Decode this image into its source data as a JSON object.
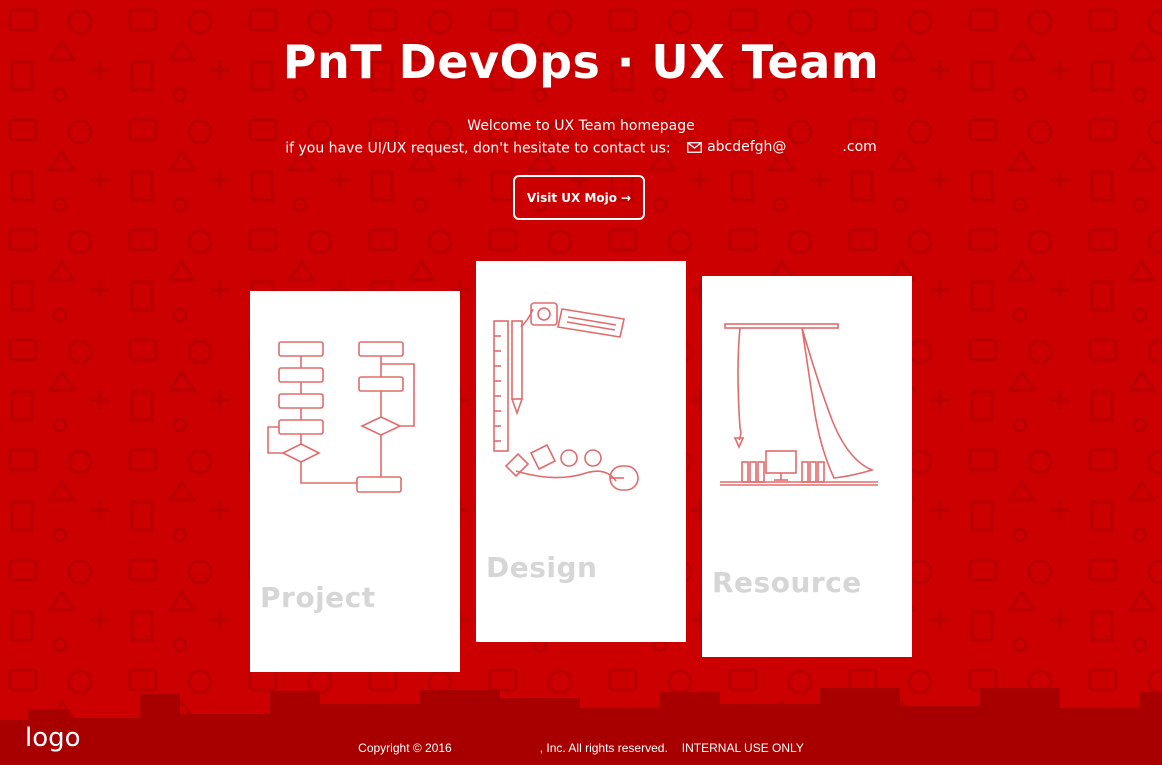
{
  "header": {
    "title": "PnT DevOps · UX Team",
    "welcome": "Welcome to UX Team homepage",
    "contact_prompt": "if you have UI/UX request, don't hesitate to contact us:",
    "email_user": "abcdefgh@",
    "email_domain": ".com"
  },
  "cta": {
    "label": "Visit UX Mojo",
    "arrow": "→"
  },
  "cards": [
    {
      "label": "Project",
      "icon": "flowchart-illustration"
    },
    {
      "label": "Design",
      "icon": "design-tools-illustration"
    },
    {
      "label": "Resource",
      "icon": "resource-room-illustration"
    }
  ],
  "footer": {
    "logo": "logo",
    "copyright": "Copyright © 2016",
    "rights": ", Inc. All rights reserved.",
    "internal": "INTERNAL USE ONLY"
  },
  "colors": {
    "background": "#cc0000",
    "skyline": "#a80000",
    "illustration": "#e26b6b",
    "card": "#ffffff",
    "card_label": "#d6d6d6"
  }
}
